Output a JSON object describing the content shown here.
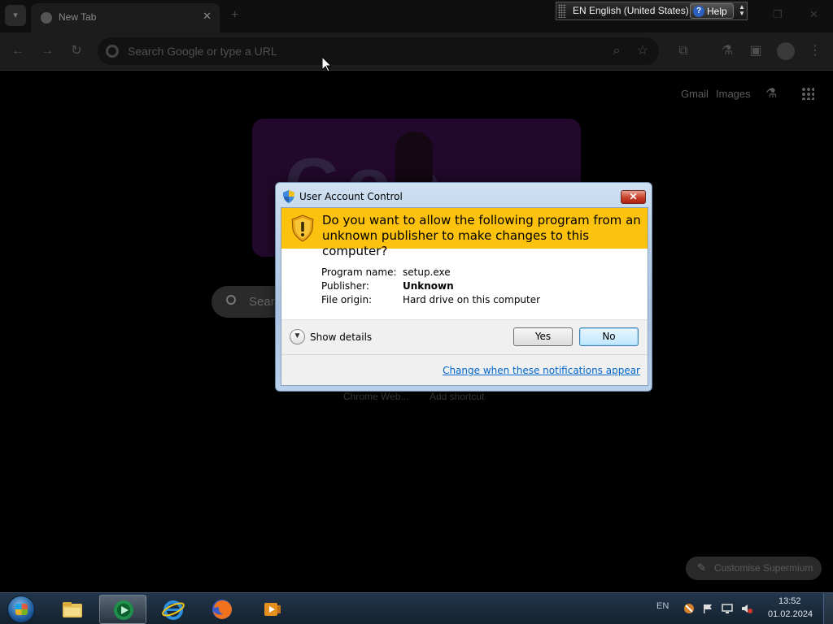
{
  "browser": {
    "tab_title": "New Tab",
    "tab_close": "✕",
    "new_tab": "+",
    "omnibox_placeholder": "Search Google or type a URL",
    "header_links": [
      "Gmail",
      "Images"
    ],
    "search_placeholder_partial": "Searc",
    "shortcuts": [
      "Chrome Web...",
      "Add shortcut"
    ],
    "customise_label": "Customise Supermium"
  },
  "language_bar": {
    "language": "EN English (United States)",
    "help": "Help",
    "help_icon": "?"
  },
  "uac": {
    "title": "User Account Control",
    "close": "✕",
    "question": "Do you want to allow the following program from an unknown publisher to make changes to this computer?",
    "details": [
      {
        "key": "Program name:",
        "value": "setup.exe"
      },
      {
        "key": "Publisher:",
        "value": "Unknown"
      },
      {
        "key": "File origin:",
        "value": "Hard drive on this computer"
      }
    ],
    "show_details": "Show details",
    "yes": "Yes",
    "no": "No",
    "link": "Change when these notifications appear"
  },
  "taskbar": {
    "tray_lang": "EN",
    "time": "13:52",
    "date": "01.02.2024",
    "apps": [
      "explorer-icon",
      "media-center-icon",
      "internet-explorer-icon",
      "firefox-icon",
      "media-player-icon"
    ]
  },
  "colors": {
    "uac_banner": "#fcc20e",
    "link_blue": "#0066cc",
    "taskbar": "#1b2c3d"
  }
}
